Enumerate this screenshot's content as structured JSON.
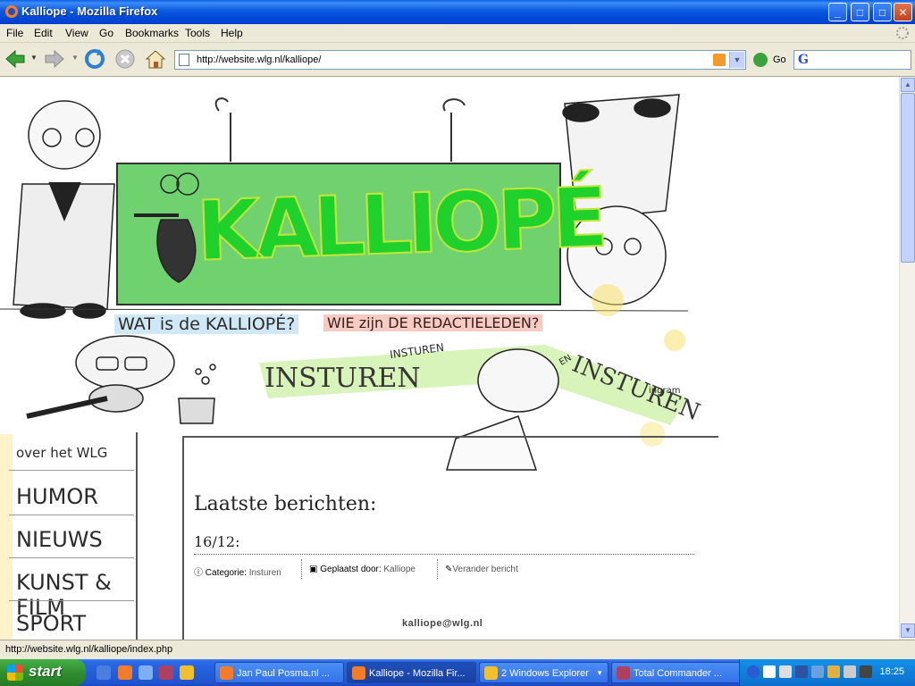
{
  "window": {
    "title": "Kalliope - Mozilla Firefox",
    "controls": {
      "minimize": "_",
      "maximize": "□",
      "close": "✕"
    }
  },
  "menu": [
    "File",
    "Edit",
    "View",
    "Go",
    "Bookmarks",
    "Tools",
    "Help"
  ],
  "nav": {
    "url": "http://website.wlg.nl/kalliope/",
    "go_label": "Go",
    "search_placeholder": ""
  },
  "page": {
    "banner_title": "KALLIOPÉ",
    "header_links": {
      "wat": "WAT is de KALLIOPÉ?",
      "wie": "WIE zijn DE REDACTIELEDEN?",
      "insturen": "INSTUREN",
      "insturen_small": "INSTUREN",
      "insturen_right": "INSTUREN",
      "en": "EN",
      "ingram": "ingram"
    },
    "left_menu": [
      "over het WLG",
      "HUMOR",
      "NIEUWS",
      "KUNST & FILM",
      "SPORT"
    ],
    "heading": "Laatste berichten:",
    "post": {
      "date": "16/12:",
      "category_label": "Categorie:",
      "category_value": "Insturen",
      "posted_label": "Geplaatst door:",
      "posted_value": "Kalliope",
      "edit_label": "Verander bericht"
    },
    "footer_email": "kalliope@wlg.nl"
  },
  "status": {
    "text": "http://website.wlg.nl/kalliope/index.php"
  },
  "taskbar": {
    "start_label": "start",
    "tasks": [
      {
        "label": "Jan Paul Posma.nl ...",
        "active": false
      },
      {
        "label": "Kalliope - Mozilla Fir...",
        "active": true
      },
      {
        "label": "2 Windows Explorer",
        "active": false
      },
      {
        "label": "Total Commander ...",
        "active": false
      }
    ],
    "clock": "18:25"
  }
}
